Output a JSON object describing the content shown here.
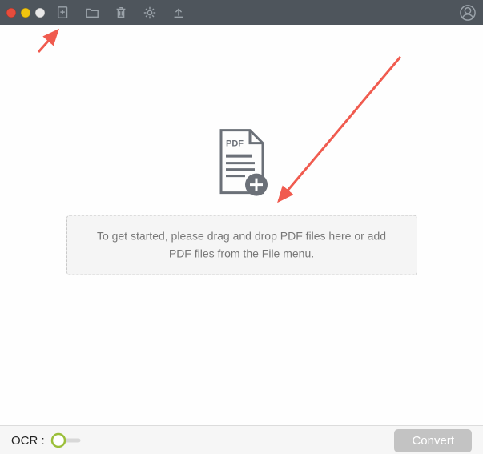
{
  "titlebar": {
    "icons": {
      "add": "add-file-icon",
      "open": "folder-icon",
      "delete": "trash-icon",
      "settings": "gear-icon",
      "export": "upload-icon",
      "help": "support-icon"
    }
  },
  "main": {
    "pdf_label": "PDF",
    "drop_message": "To get started, please drag and drop PDF files here or add PDF files from the File menu."
  },
  "bottom": {
    "ocr_label": "OCR :",
    "ocr_enabled": false,
    "convert_label": "Convert"
  },
  "colors": {
    "titlebar_bg": "#4e555c",
    "icon_stroke": "#9aa2a9",
    "drop_border": "#c9c9c9",
    "drop_bg": "#f5f5f5",
    "drop_text": "#777777",
    "convert_disabled_bg": "#c3c3c3",
    "arrow": "#f05b4f",
    "ocr_ring": "#9bbf3a"
  }
}
